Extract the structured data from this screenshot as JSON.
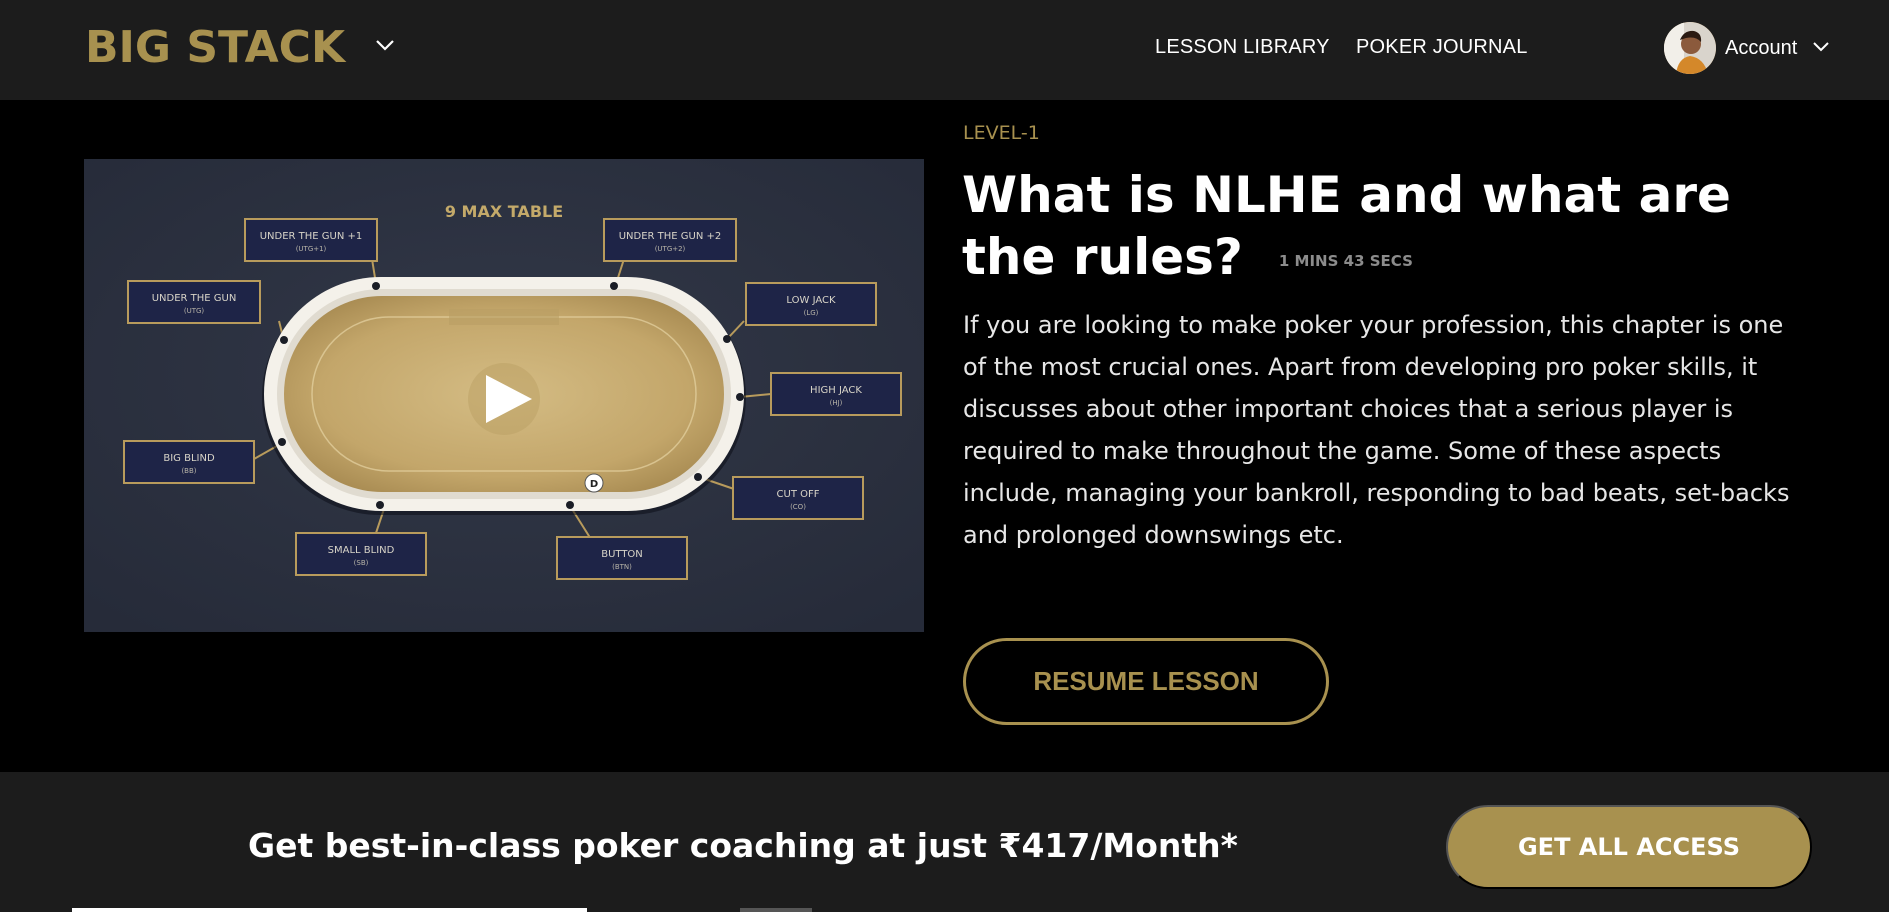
{
  "header": {
    "logo_text": "BIG STACK",
    "nav": [
      {
        "label": "LESSON LIBRARY"
      },
      {
        "label": "POKER JOURNAL"
      }
    ],
    "account_label": "Account"
  },
  "video": {
    "table_title": "9  MAX TABLE",
    "seats": [
      {
        "name": "UNDER THE GUN +1",
        "abbr": "(UTG+1)"
      },
      {
        "name": "UNDER THE GUN +2",
        "abbr": "(UTG+2)"
      },
      {
        "name": "UNDER THE GUN",
        "abbr": "(UTG)"
      },
      {
        "name": "LOW JACK",
        "abbr": "(LG)"
      },
      {
        "name": "HIGH JACK",
        "abbr": "(HJ)"
      },
      {
        "name": "BIG BLIND",
        "abbr": "(BB)"
      },
      {
        "name": "CUT OFF",
        "abbr": "(CO)"
      },
      {
        "name": "SMALL BLIND",
        "abbr": "(SB)"
      },
      {
        "name": "BUTTON",
        "abbr": "(BTN)"
      }
    ],
    "dealer_button": "D"
  },
  "lesson": {
    "level": "LEVEL-1",
    "title": "What is NLHE and what are the rules?",
    "duration": "1 MINS 43 SECS",
    "description": "If you are looking to make poker your profession, this chapter is one of the most crucial ones. Apart from developing pro poker skills, it discusses about other important choices that a serious player is required to make throughout the game. Some of these aspects include, managing your bankroll, responding to bad beats, set-backs and prolonged downswings etc.",
    "resume_label": "RESUME LESSON"
  },
  "banner": {
    "promo_text": "Get best-in-class poker coaching at just ₹417/Month*",
    "access_label": "GET ALL ACCESS"
  },
  "colors": {
    "brand_gold": "#a8914f",
    "header_bg": "#1c1c1c",
    "video_bg": "#2b3040",
    "seat_box": "#1e2447"
  }
}
